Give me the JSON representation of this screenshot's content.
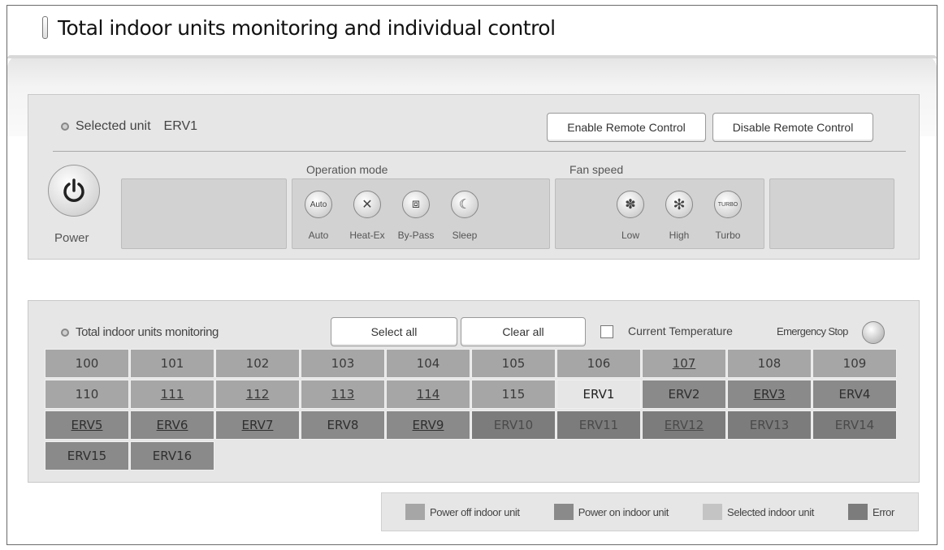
{
  "title": "Total indoor units monitoring and individual control",
  "control": {
    "selected_label": "Selected unit",
    "selected_value": "ERV1",
    "enable_remote": "Enable Remote Control",
    "disable_remote": "Disable Remote Control",
    "power_label": "Power",
    "operation_mode_title": "Operation mode",
    "operation_modes": [
      {
        "label": "Auto",
        "icon": "auto-icon",
        "glyph": "Auto"
      },
      {
        "label": "Heat-Ex",
        "icon": "heat-exchange-icon",
        "glyph": "✕"
      },
      {
        "label": "By-Pass",
        "icon": "bypass-icon",
        "glyph": "⧈"
      },
      {
        "label": "Sleep",
        "icon": "sleep-icon",
        "glyph": "☾"
      }
    ],
    "fan_speed_title": "Fan speed",
    "fan_speeds": [
      {
        "label": "Low",
        "icon": "fan-low-icon",
        "glyph": "✽"
      },
      {
        "label": "High",
        "icon": "fan-high-icon",
        "glyph": "✻"
      },
      {
        "label": "Turbo",
        "icon": "turbo-icon",
        "glyph": "TURBO"
      }
    ]
  },
  "monitoring": {
    "label": "Total indoor units monitoring",
    "select_all": "Select all",
    "clear_all": "Clear all",
    "current_temperature": "Current Temperature",
    "emergency_stop": "Emergency Stop",
    "units": [
      {
        "name": "100",
        "status": "off",
        "underline": false
      },
      {
        "name": "101",
        "status": "off",
        "underline": false
      },
      {
        "name": "102",
        "status": "off",
        "underline": false
      },
      {
        "name": "103",
        "status": "off",
        "underline": false
      },
      {
        "name": "104",
        "status": "off",
        "underline": false
      },
      {
        "name": "105",
        "status": "off",
        "underline": false
      },
      {
        "name": "106",
        "status": "off",
        "underline": false
      },
      {
        "name": "107",
        "status": "off",
        "underline": true
      },
      {
        "name": "108",
        "status": "off",
        "underline": false
      },
      {
        "name": "109",
        "status": "off",
        "underline": false
      },
      {
        "name": "110",
        "status": "off",
        "underline": false
      },
      {
        "name": "111",
        "status": "off",
        "underline": true
      },
      {
        "name": "112",
        "status": "off",
        "underline": true
      },
      {
        "name": "113",
        "status": "off",
        "underline": true
      },
      {
        "name": "114",
        "status": "off",
        "underline": true
      },
      {
        "name": "115",
        "status": "off",
        "underline": false
      },
      {
        "name": "ERV1",
        "status": "selected",
        "underline": false
      },
      {
        "name": "ERV2",
        "status": "on",
        "underline": false
      },
      {
        "name": "ERV3",
        "status": "on",
        "underline": true
      },
      {
        "name": "ERV4",
        "status": "on",
        "underline": false
      },
      {
        "name": "ERV5",
        "status": "on",
        "underline": true
      },
      {
        "name": "ERV6",
        "status": "on",
        "underline": true
      },
      {
        "name": "ERV7",
        "status": "on",
        "underline": true
      },
      {
        "name": "ERV8",
        "status": "on",
        "underline": false
      },
      {
        "name": "ERV9",
        "status": "on",
        "underline": true
      },
      {
        "name": "ERV10",
        "status": "error",
        "underline": false
      },
      {
        "name": "ERV11",
        "status": "error",
        "underline": false
      },
      {
        "name": "ERV12",
        "status": "error",
        "underline": true
      },
      {
        "name": "ERV13",
        "status": "error",
        "underline": false
      },
      {
        "name": "ERV14",
        "status": "error",
        "underline": false
      },
      {
        "name": "ERV15",
        "status": "on",
        "underline": false
      },
      {
        "name": "ERV16",
        "status": "on",
        "underline": false
      }
    ]
  },
  "legend": [
    {
      "label": "Power off indoor unit",
      "color": "#a6a6a6"
    },
    {
      "label": "Power on indoor unit",
      "color": "#8a8a8a"
    },
    {
      "label": "Selected indoor unit",
      "color": "#c4c4c4"
    },
    {
      "label": "Error",
      "color": "#7c7c7c"
    }
  ]
}
